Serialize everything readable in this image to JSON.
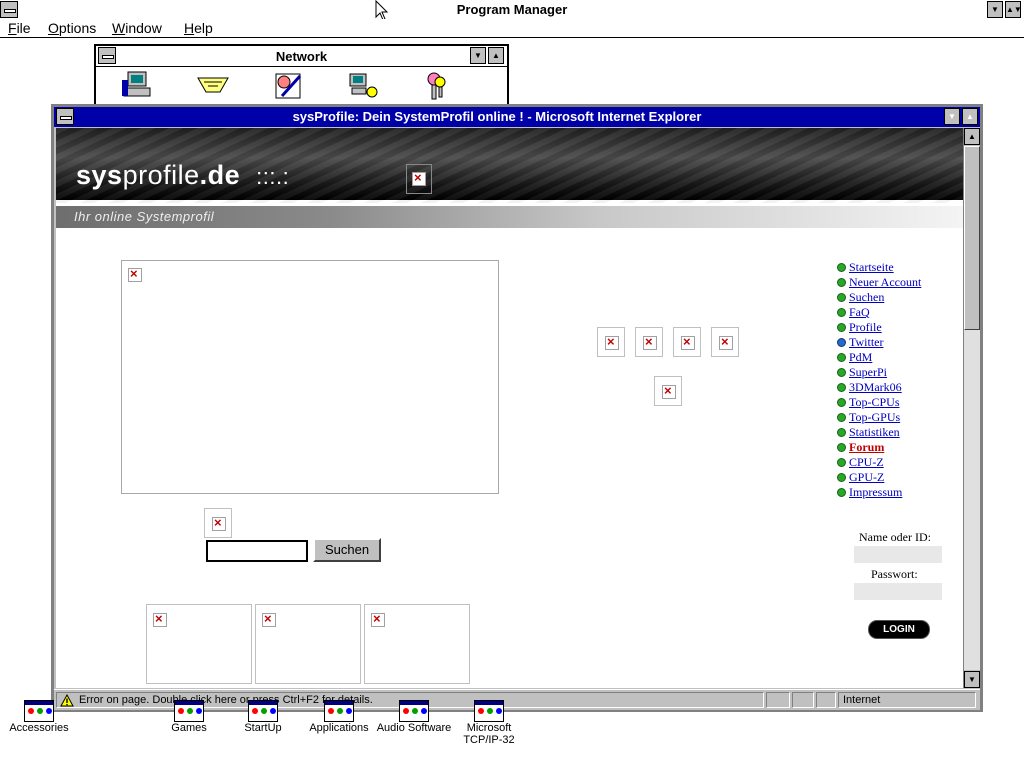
{
  "program_manager": {
    "title": "Program Manager",
    "menu": [
      "File",
      "Options",
      "Window",
      "Help"
    ]
  },
  "network_group": {
    "title": "Network",
    "icons": [
      "network-computer-icon",
      "network-cable-icon",
      "network-schedule-icon",
      "network-printer-icon",
      "network-keys-icon"
    ]
  },
  "ie_window": {
    "title": "sysProfile: Dein SystemProfil online ! - Microsoft Internet Explorer",
    "status_text": "Error on page. Double click here or press Ctrl+F2 for details.",
    "status_zone": "Internet"
  },
  "page": {
    "logo_bold": "sys",
    "logo_light": "profile",
    "logo_tld": ".de",
    "logo_dots": ":::.:",
    "tagline": "Ihr online Systemprofil",
    "search_button": "Suchen",
    "nav": [
      {
        "label": "Startseite",
        "style": "normal",
        "dot": "green"
      },
      {
        "label": "Neuer Account",
        "style": "normal",
        "dot": "green"
      },
      {
        "label": "Suchen",
        "style": "normal",
        "dot": "green"
      },
      {
        "label": "FaQ",
        "style": "normal",
        "dot": "green"
      },
      {
        "label": "Profile",
        "style": "normal",
        "dot": "green"
      },
      {
        "label": "Twitter",
        "style": "normal",
        "dot": "blue"
      },
      {
        "label": "PdM",
        "style": "normal",
        "dot": "green"
      },
      {
        "label": "SuperPi",
        "style": "normal",
        "dot": "green"
      },
      {
        "label": "3DMark06",
        "style": "normal",
        "dot": "green"
      },
      {
        "label": "Top-CPUs",
        "style": "normal",
        "dot": "green"
      },
      {
        "label": "Top-GPUs",
        "style": "normal",
        "dot": "green"
      },
      {
        "label": "Statistiken",
        "style": "normal",
        "dot": "green"
      },
      {
        "label": "Forum",
        "style": "highlight",
        "dot": "green"
      },
      {
        "label": "CPU-Z",
        "style": "normal",
        "dot": "green"
      },
      {
        "label": "GPU-Z",
        "style": "normal",
        "dot": "green"
      },
      {
        "label": "Impressum",
        "style": "normal",
        "dot": "green"
      }
    ],
    "login": {
      "name_label": "Name oder ID:",
      "password_label": "Passwort:",
      "button": "LOGIN"
    }
  },
  "desktop_icons": [
    {
      "label": "Accessories"
    },
    {
      "label": "Games"
    },
    {
      "label": "StartUp"
    },
    {
      "label": "Applications"
    },
    {
      "label": "Audio Software"
    },
    {
      "label": "Microsoft TCP/IP-32"
    }
  ]
}
